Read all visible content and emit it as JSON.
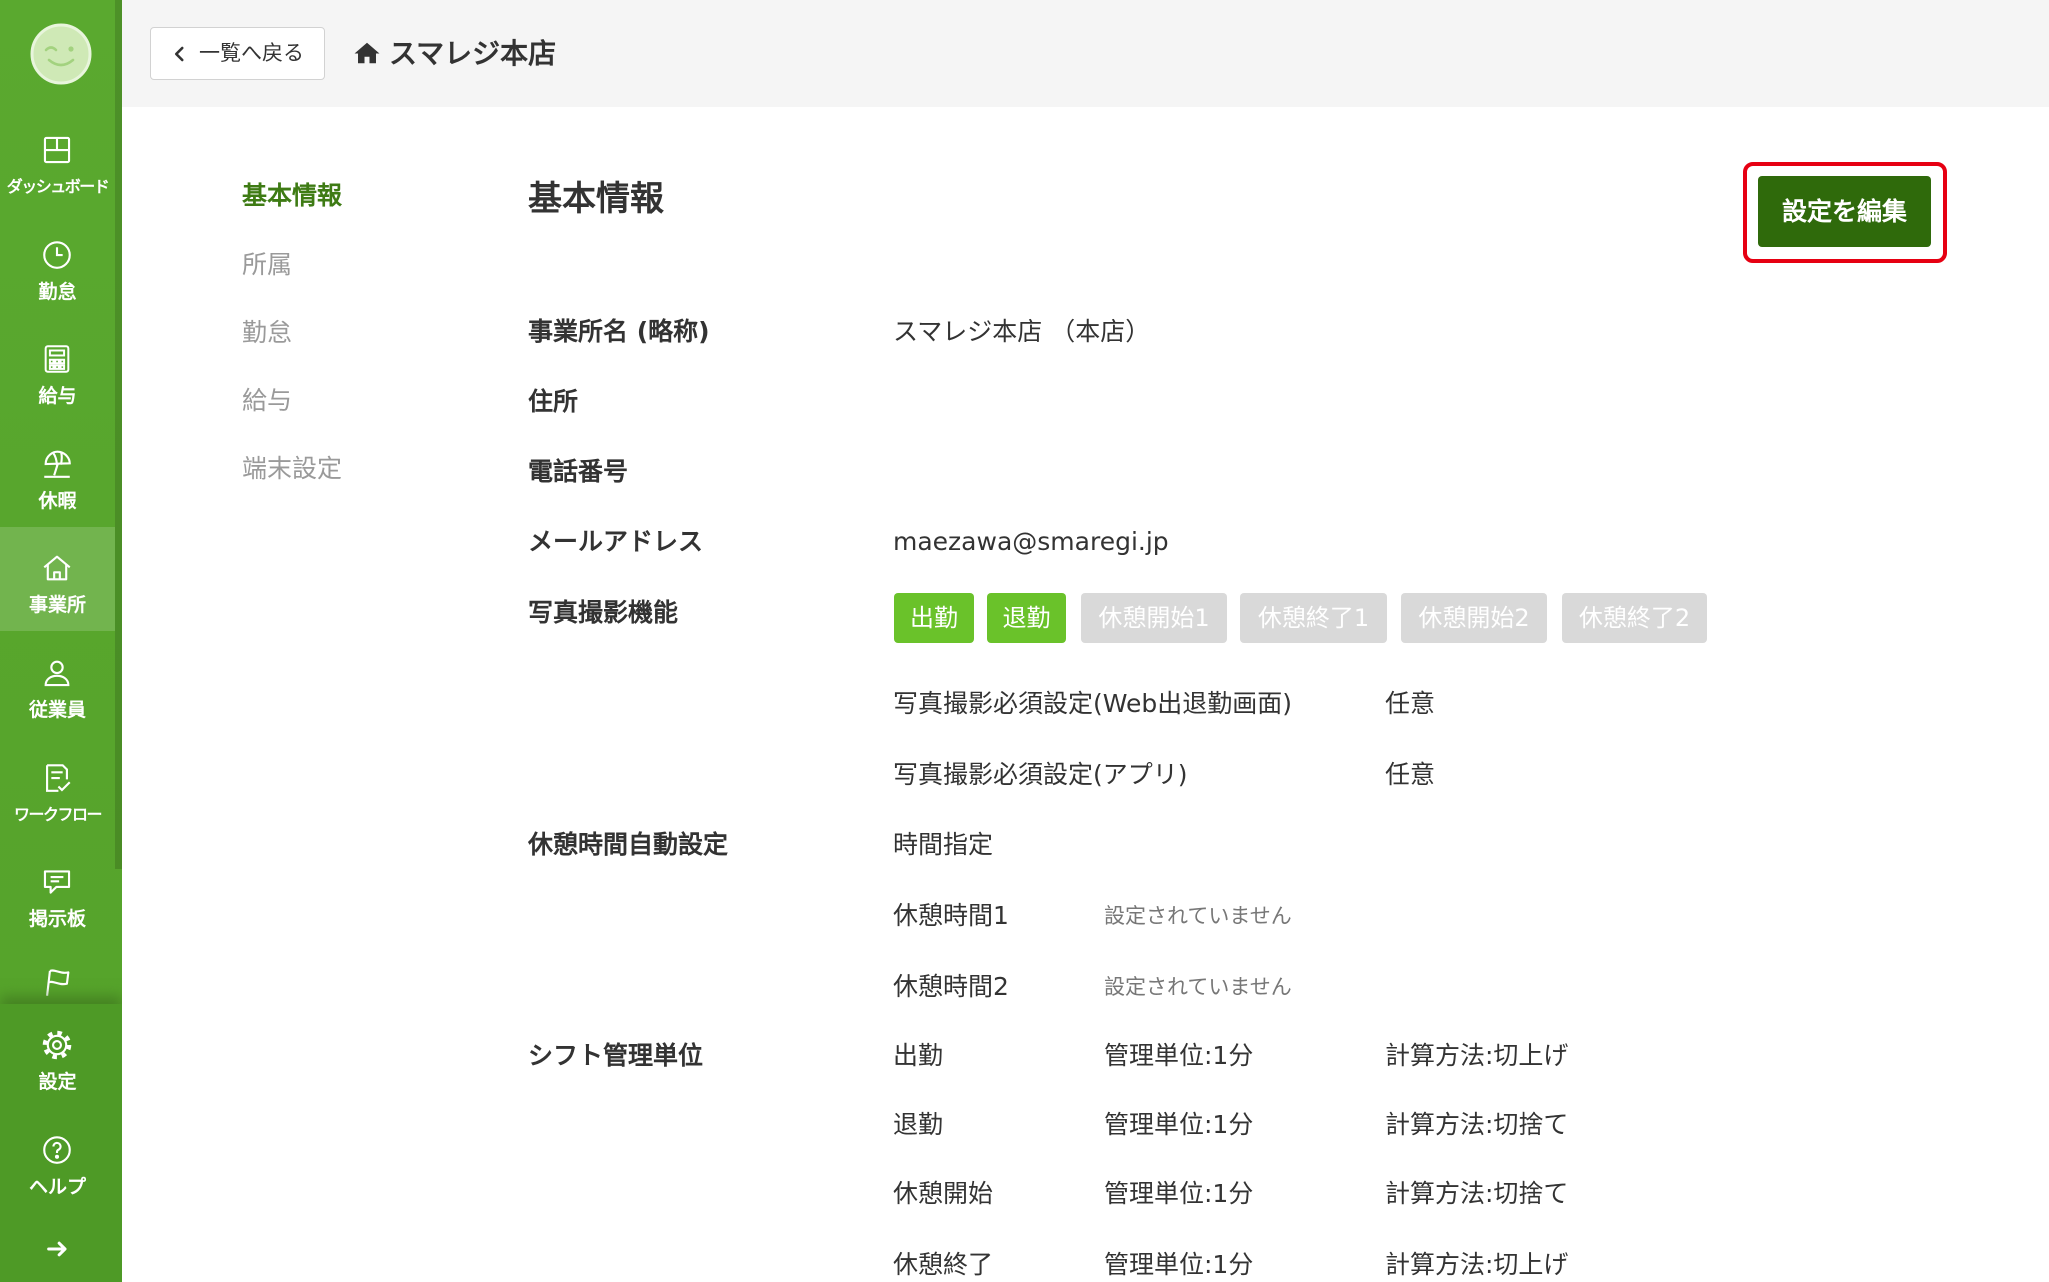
{
  "sidebar": {
    "avatar_icon": "smiley-avatar-icon",
    "items": [
      {
        "label": "ダッシュボード",
        "icon": "dashboard-icon"
      },
      {
        "label": "勤怠",
        "icon": "clock-icon"
      },
      {
        "label": "給与",
        "icon": "calculator-icon"
      },
      {
        "label": "休暇",
        "icon": "beach-umbrella-icon"
      },
      {
        "label": "事業所",
        "icon": "home-icon",
        "active": true
      },
      {
        "label": "従業員",
        "icon": "user-icon"
      },
      {
        "label": "ワークフロー",
        "icon": "checklist-icon"
      },
      {
        "label": "掲示板",
        "icon": "message-board-icon"
      },
      {
        "icon": "flag-icon"
      }
    ],
    "bottom_items": [
      {
        "label": "設定",
        "icon": "gear-icon"
      },
      {
        "label": "ヘルプ",
        "icon": "help-icon"
      }
    ],
    "expand_icon": "arrow-right-icon"
  },
  "header": {
    "back_label": "一覧へ戻る",
    "back_icon": "chevron-left-icon",
    "title_icon": "home-icon",
    "title": "スマレジ本店"
  },
  "subnav": {
    "items": [
      {
        "label": "基本情報",
        "active": true
      },
      {
        "label": "所属"
      },
      {
        "label": "勤怠"
      },
      {
        "label": "給与"
      },
      {
        "label": "端末設定"
      }
    ]
  },
  "main": {
    "title": "基本情報",
    "edit_button": "設定を編集",
    "office_name": {
      "label": "事業所名 (略称)",
      "value": "スマレジ本店 （本店）"
    },
    "address": {
      "label": "住所"
    },
    "phone": {
      "label": "電話番号"
    },
    "email": {
      "label": "メールアドレス",
      "value": "maezawa@smaregi.jp"
    },
    "photo": {
      "label": "写真撮影機能",
      "tags": [
        {
          "label": "出勤",
          "enabled": true
        },
        {
          "label": "退勤",
          "enabled": true
        },
        {
          "label": "休憩開始1",
          "enabled": false
        },
        {
          "label": "休憩終了1",
          "enabled": false
        },
        {
          "label": "休憩開始2",
          "enabled": false
        },
        {
          "label": "休憩終了2",
          "enabled": false
        }
      ],
      "required_web": {
        "label": "写真撮影必須設定(Web出退勤画面)",
        "value": "任意"
      },
      "required_app": {
        "label": "写真撮影必須設定(アプリ)",
        "value": "任意"
      }
    },
    "break_auto": {
      "label": "休憩時間自動設定",
      "value": "時間指定",
      "breaks": [
        {
          "label": "休憩時間1",
          "value": "設定されていません"
        },
        {
          "label": "休憩時間2",
          "value": "設定されていません"
        }
      ]
    },
    "shift_unit": {
      "label": "シフト管理単位",
      "rows": [
        {
          "type": "出勤",
          "unit": "管理単位:1分",
          "method": "計算方法:切上げ"
        },
        {
          "type": "退勤",
          "unit": "管理単位:1分",
          "method": "計算方法:切捨て"
        },
        {
          "type": "休憩開始",
          "unit": "管理単位:1分",
          "method": "計算方法:切捨て"
        },
        {
          "type": "休憩終了",
          "unit": "管理単位:1分",
          "method": "計算方法:切上げ"
        }
      ]
    }
  },
  "colors": {
    "sidebar_green": "#58a62d",
    "sidebar_bottom_green": "#4e9a26",
    "active_nav_green": "#3e7b14",
    "edit_button_green": "#2f6a0b",
    "tag_enabled_green": "#6ac22a",
    "tag_disabled_gray": "#d9d9d9",
    "highlight_red": "#e60012",
    "header_bg": "#f5f5f5"
  }
}
